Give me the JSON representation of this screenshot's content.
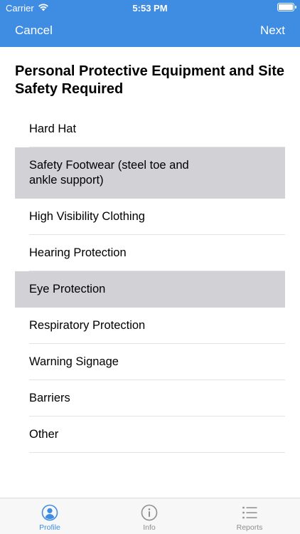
{
  "status": {
    "carrier": "Carrier",
    "time": "5:53 PM"
  },
  "nav": {
    "cancel_label": "Cancel",
    "next_label": "Next"
  },
  "page": {
    "title": "Personal Protective Equipment and Site Safety Required"
  },
  "list": {
    "items": [
      {
        "label": "Hard Hat",
        "selected": false
      },
      {
        "label": "Safety Footwear (steel toe and ankle support)",
        "selected": true
      },
      {
        "label": "High Visibility Clothing",
        "selected": false
      },
      {
        "label": "Hearing Protection",
        "selected": false
      },
      {
        "label": "Eye Protection",
        "selected": true
      },
      {
        "label": "Respiratory Protection",
        "selected": false
      },
      {
        "label": "Warning Signage",
        "selected": false
      },
      {
        "label": "Barriers",
        "selected": false
      },
      {
        "label": "Other",
        "selected": false
      }
    ]
  },
  "tabs": {
    "profile": {
      "label": "Profile",
      "icon": "profile-icon",
      "active": true
    },
    "info": {
      "label": "Info",
      "icon": "info-icon",
      "active": false
    },
    "reports": {
      "label": "Reports",
      "icon": "list-icon",
      "active": false
    }
  },
  "colors": {
    "accent": "#3f8ce3",
    "selected_row": "#d1d1d6",
    "tab_inactive": "#8e8e93"
  }
}
